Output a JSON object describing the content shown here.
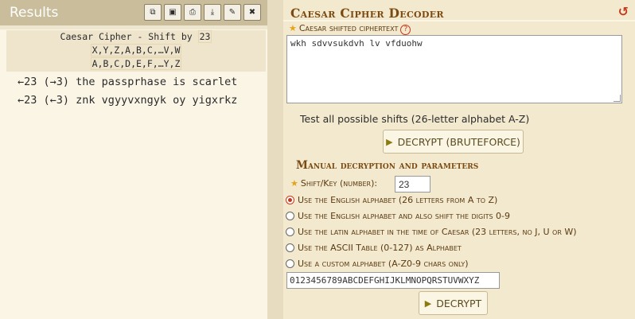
{
  "results": {
    "title": "Results",
    "tools": [
      {
        "name": "copy-icon",
        "glyph": "⧉"
      },
      {
        "name": "save-icon",
        "glyph": "▣"
      },
      {
        "name": "print-icon",
        "glyph": "⎙"
      },
      {
        "name": "download-icon",
        "glyph": "⤓"
      },
      {
        "name": "pin-icon",
        "glyph": "✎"
      },
      {
        "name": "close-icon",
        "glyph": "✖"
      }
    ],
    "info_prefix": "Caesar Cipher - Shift by",
    "info_shift": "23",
    "info_line2": "X,Y,Z,A,B,C,…V,W",
    "info_line3": "A,B,C,D,E,F,…Y,Z",
    "rows": [
      {
        "shift": "←23 (→3)",
        "text": "the passprhase is scarlet"
      },
      {
        "shift": "←23 (←3)",
        "text": "znk vgyyvxngyk oy yigxrkz"
      }
    ]
  },
  "decoder": {
    "title": "Caesar Cipher Decoder",
    "ciphertext_label": "Caesar shifted ciphertext",
    "ciphertext_value": "wkh sdvvsukdvh lv vfduohw",
    "test_label": "Test all possible shifts (26-letter alphabet A-Z)",
    "bruteforce_label": "DECRYPT (BRUTEFORCE)",
    "manual_title": "Manual decryption and parameters",
    "shift_label": "Shift/Key (number):",
    "shift_value": "23",
    "options": [
      {
        "label": "Use the English alphabet (26 letters from A to Z)",
        "checked": true
      },
      {
        "label": "Use the English alphabet and also shift the digits 0-9",
        "checked": false
      },
      {
        "label": "Use the latin alphabet in the time of Caesar (23 letters, no J, U or W)",
        "checked": false
      },
      {
        "label": "Use the ASCII Table (0-127) as Alphabet",
        "checked": false
      },
      {
        "label": "Use a custom alphabet (A-Z0-9 chars only)",
        "checked": false
      }
    ],
    "custom_alphabet": "0123456789ABCDEFGHIJKLMNOPQRSTUVWXYZ",
    "decrypt_label": "DECRYPT"
  }
}
